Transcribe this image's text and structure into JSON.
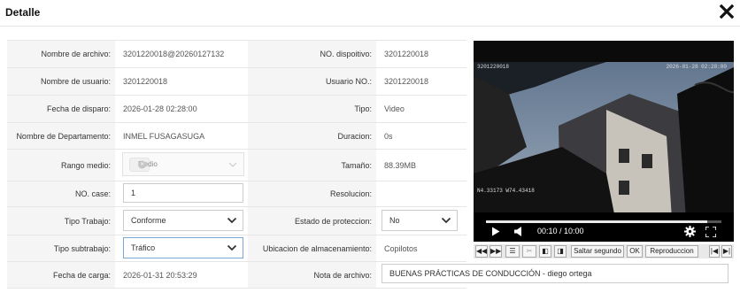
{
  "dialog": {
    "title": "Detalle"
  },
  "fields": {
    "nombre_archivo": {
      "label": "Nombre de archivo:",
      "value": "3201220018@20260127132"
    },
    "nombre_usuario": {
      "label": "Nombre de usuario:",
      "value": "3201220018"
    },
    "fecha_disparo": {
      "label": "Fecha de disparo:",
      "value": "2026-01-28 02:28:00"
    },
    "departamento": {
      "label": "Nombre de Departamento:",
      "value": "INMEL FUSAGASUGA"
    },
    "rango_medio": {
      "label": "Rango medio:",
      "tag": "Medio"
    },
    "no_case": {
      "label": "NO. case:",
      "value": "1"
    },
    "tipo_trabajo": {
      "label": "Tipo Trabajo:",
      "value": "Conforme"
    },
    "tipo_subtrabajo": {
      "label": "Tipo subtrabajo:",
      "value": "Tráfico"
    },
    "fecha_carga": {
      "label": "Fecha de carga:",
      "value": "2026-01-31 20:53:29"
    },
    "no_dispositivo": {
      "label": "NO. dispoitivo:",
      "value": "3201220018"
    },
    "usuario_no": {
      "label": "Usuario NO.:",
      "value": "3201220018"
    },
    "tipo": {
      "label": "Tipo:",
      "value": "Video"
    },
    "duracion": {
      "label": "Duracion:",
      "value": "0s"
    },
    "tamano": {
      "label": "Tamaño:",
      "value": "88.39MB"
    },
    "resolucion": {
      "label": "Resolucion:",
      "value": ""
    },
    "estado_proteccion": {
      "label": "Estado de proteccion:",
      "value": "No"
    },
    "ubicacion": {
      "label": "Ubicacion de almacenamiento:",
      "value": "Copilotos"
    },
    "nota_archivo": {
      "label": "Nota de archivo:",
      "value": "BUENAS PRÁCTICAS DE CONDUCCIÓN - diego ortega"
    }
  },
  "video": {
    "time_display": "00:10 / 10:00",
    "progress_fraction": 0.94,
    "overlay_top_left": "3201220018",
    "overlay_top_right": "2026-01-28 02:28:00",
    "overlay_bottom": "N4.33173 W74.43418"
  },
  "toolbar": {
    "skip_label": "Saltar segundo",
    "ok_label": "OK",
    "playback_label": "Reproduccion"
  },
  "icons": {
    "close": "close-icon",
    "play": "play-icon",
    "volume": "volume-icon",
    "settings": "gear-icon",
    "fullscreen": "fullscreen-icon"
  },
  "colors": {
    "label_bg": "#f5f5f5",
    "focus_border": "#7aa6d8",
    "video_bg": "#000000"
  }
}
